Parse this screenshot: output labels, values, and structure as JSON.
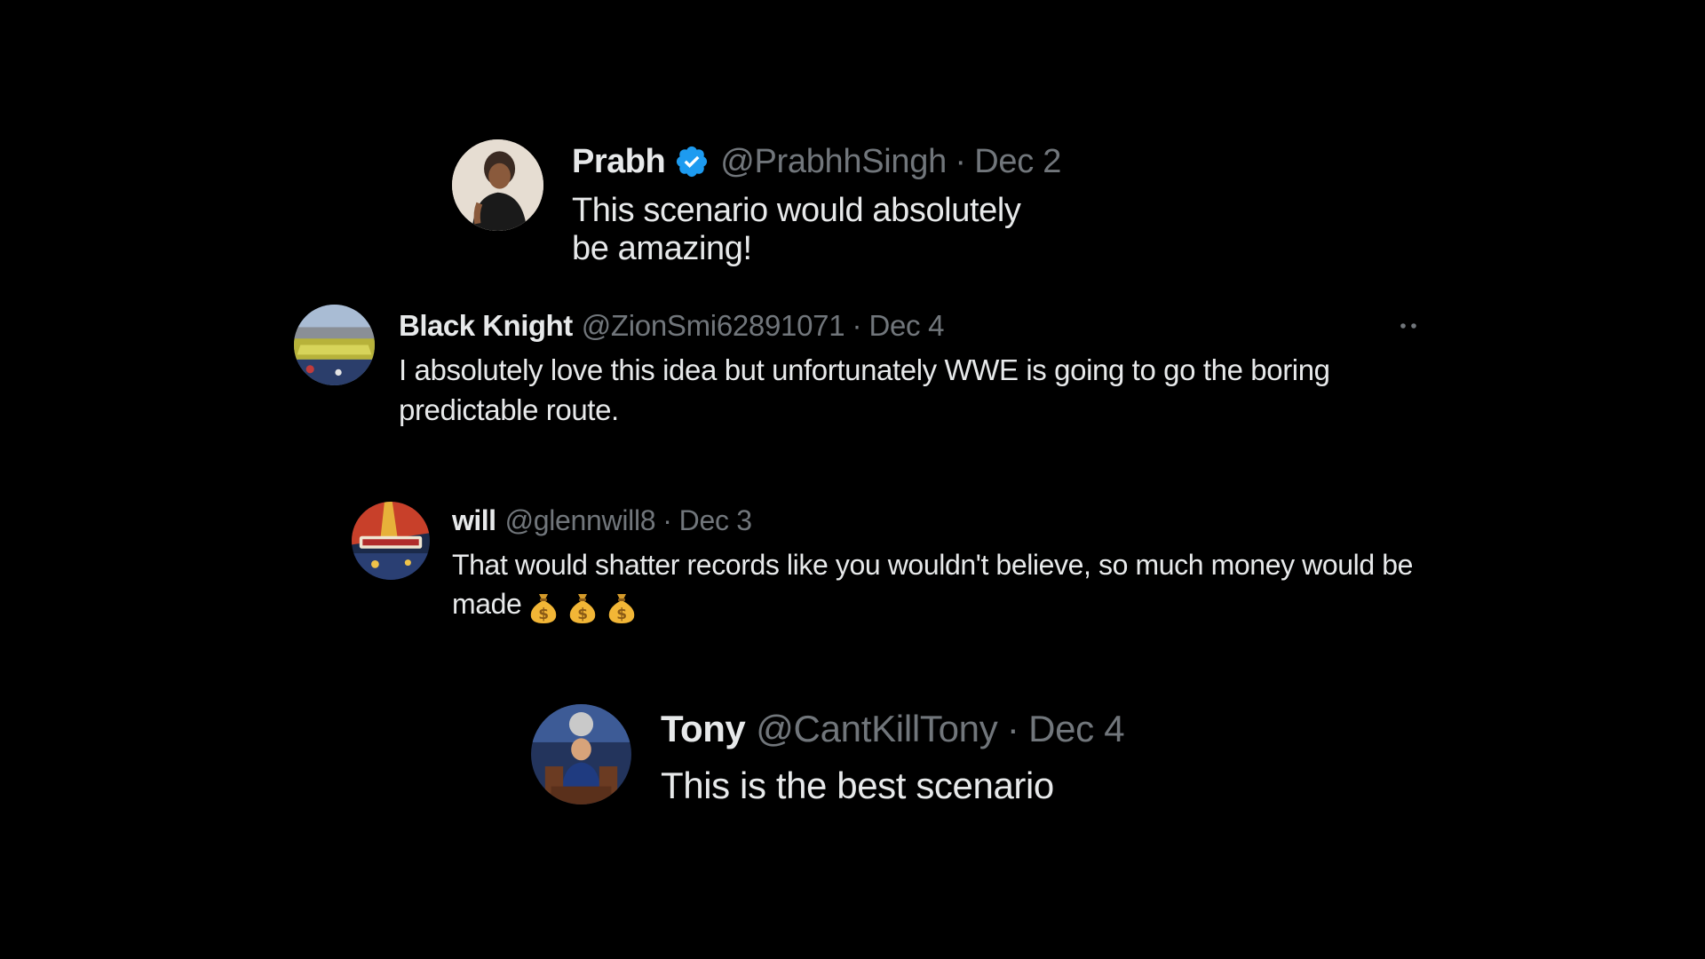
{
  "tweets": [
    {
      "name": "Prabh",
      "verified": true,
      "handle": "@PrabhhSingh",
      "separator": "·",
      "date": "Dec 2",
      "text": "This scenario would absolutely be amazing!"
    },
    {
      "name": "Black Knight",
      "verified": false,
      "handle": "@ZionSmi62891071",
      "separator": "·",
      "date": "Dec 4",
      "text": "I absolutely love this idea but unfortunately WWE is going to go the boring predictable route.",
      "more_icon": "more-dots-icon"
    },
    {
      "name": "will",
      "verified": false,
      "handle": "@glennwill8",
      "separator": "·",
      "date": "Dec 3",
      "text": "That would shatter records like you wouldn't believe, so much money would be made",
      "emoji": [
        "money-bag-icon",
        "money-bag-icon",
        "money-bag-icon"
      ]
    },
    {
      "name": "Tony",
      "verified": false,
      "handle": "@CantKillTony",
      "separator": "·",
      "date": "Dec 4",
      "text": "This is the best scenario"
    }
  ],
  "colors": {
    "background": "#000000",
    "primary_text": "#e7e9ea",
    "secondary_text": "#71767b",
    "verified_badge": "#1d9bf0"
  }
}
